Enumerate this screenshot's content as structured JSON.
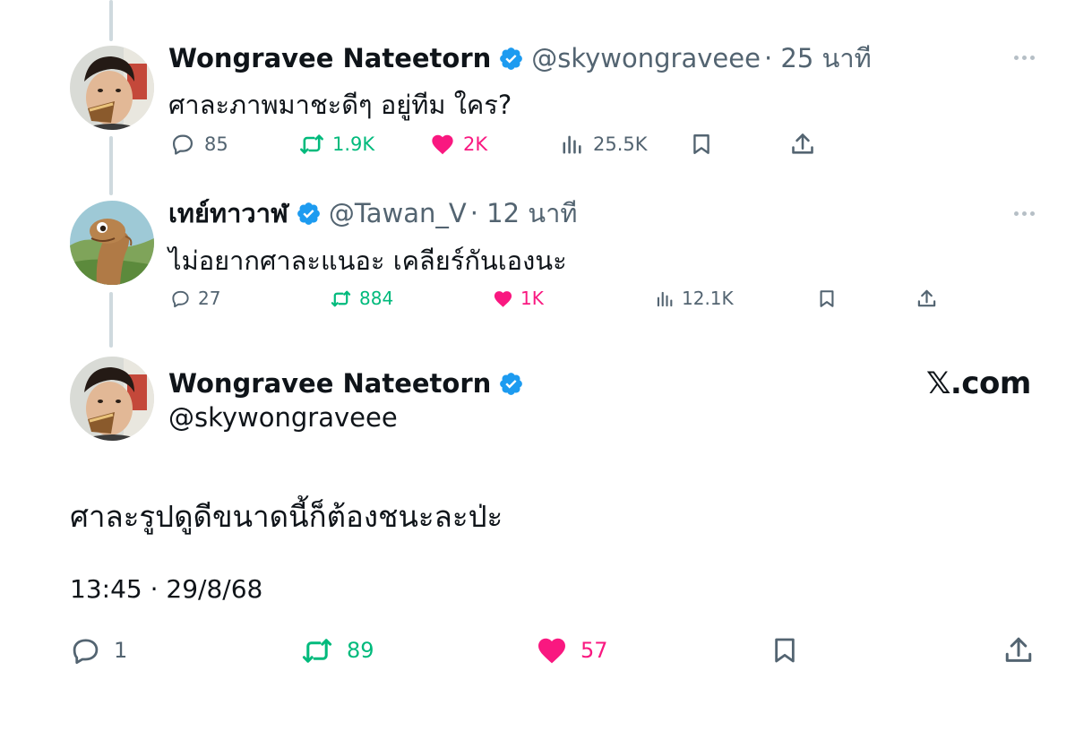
{
  "colors": {
    "verified": "#1d9bf0",
    "retweet": "#00ba7c",
    "like": "#f91880",
    "muted": "#536471",
    "text": "#0f1419",
    "thread_line": "#cfd9de"
  },
  "replies": [
    {
      "display_name": "Wongravee Nateetorn",
      "handle": "@skywongraveee",
      "time": "· 25 นาที",
      "text": "ศาละภาพมาชะดีๆ อยู่ทีม ใคร?",
      "stats": {
        "replies": "85",
        "reposts": "1.9K",
        "likes": "2K",
        "views": "25.5K"
      },
      "liked": true,
      "reposted": true
    },
    {
      "display_name": "เทย์ทาวาฬ",
      "handle": "@Tawan_V",
      "time": "· 12 นาที",
      "text": "ไม่อยากศาละแนอะ เคลียร์กันเองนะ",
      "stats": {
        "replies": "27",
        "reposts": "884",
        "likes": "1K",
        "views": "12.1K"
      },
      "liked": true,
      "reposted": true
    }
  ],
  "main": {
    "display_name": "Wongravee Nateetorn",
    "handle": "@skywongraveee",
    "brand": "𝕏.com",
    "text": "ศาละรูปดูดีขนาดนี้ก็ต้องชนะละป่ะ",
    "timestamp": "13:45 · 29/8/68",
    "stats": {
      "replies": "1",
      "reposts": "89",
      "likes": "57"
    },
    "liked": true,
    "reposted": true
  },
  "icons": {
    "reply": "speech-bubble-icon",
    "repost": "repost-arrows-icon",
    "like": "heart-icon",
    "views": "bar-chart-icon",
    "bookmark": "bookmark-icon",
    "share": "share-upload-icon",
    "verified": "verified-badge-icon",
    "more": "more-dots-icon"
  }
}
